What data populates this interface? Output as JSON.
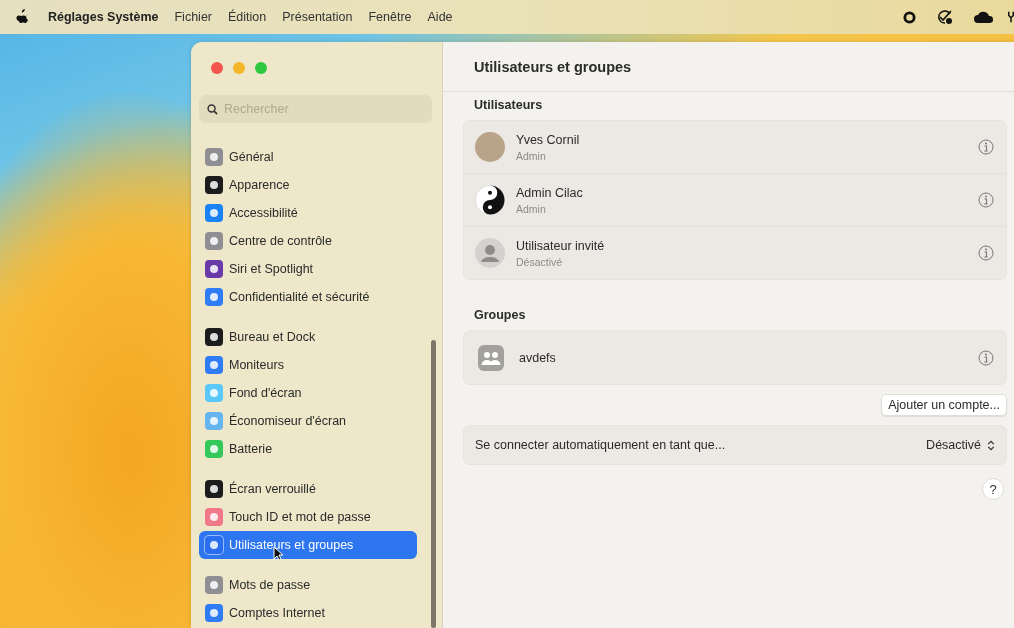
{
  "menu_bar": {
    "app_name": "Réglages Système",
    "menus": [
      "Fichier",
      "Édition",
      "Présentation",
      "Fenêtre",
      "Aide"
    ]
  },
  "sidebar": {
    "search": {
      "placeholder": "Rechercher"
    },
    "groups": [
      [
        {
          "label": "Général",
          "color": "#8e8e93",
          "selected": false
        },
        {
          "label": "Apparence",
          "color": "#1c1c1e",
          "selected": false
        },
        {
          "label": "Accessibilité",
          "color": "#1a82f7",
          "selected": false
        },
        {
          "label": "Centre de contrôle",
          "color": "#8e8e93",
          "selected": false
        },
        {
          "label": "Siri et Spotlight",
          "color": "#6a3aa8",
          "selected": false
        },
        {
          "label": "Confidentialité et sécurité",
          "color": "#2f7cf6",
          "selected": false
        }
      ],
      [
        {
          "label": "Bureau et Dock",
          "color": "#1c1c1e",
          "selected": false
        },
        {
          "label": "Moniteurs",
          "color": "#2f7cf6",
          "selected": false
        },
        {
          "label": "Fond d'écran",
          "color": "#5ac8fa",
          "selected": false
        },
        {
          "label": "Économiseur d'écran",
          "color": "#64b5f0",
          "selected": false
        },
        {
          "label": "Batterie",
          "color": "#34c759",
          "selected": false
        }
      ],
      [
        {
          "label": "Écran verrouillé",
          "color": "#1c1c1e",
          "selected": false
        },
        {
          "label": "Touch ID et mot de passe",
          "color": "#f07888",
          "selected": false
        },
        {
          "label": "Utilisateurs et groupes",
          "color": "#2a6ef0",
          "selected": true
        }
      ],
      [
        {
          "label": "Mots de passe",
          "color": "#8e8e93",
          "selected": false
        },
        {
          "label": "Comptes Internet",
          "color": "#2f7cf6",
          "selected": false
        }
      ]
    ]
  },
  "content": {
    "title": "Utilisateurs et groupes",
    "users_heading": "Utilisateurs",
    "users": [
      {
        "name": "Yves Cornil",
        "role": "Admin",
        "kind": "photo"
      },
      {
        "name": "Admin Cilac",
        "role": "Admin",
        "kind": "yinyang"
      },
      {
        "name": "Utilisateur invité",
        "role": "Désactivé",
        "kind": "silhouette"
      }
    ],
    "groups_heading": "Groupes",
    "groups": [
      {
        "name": "avdefs"
      }
    ],
    "add_button": "Ajouter un compte...",
    "auto_login": {
      "label": "Se connecter automatiquement en tant que...",
      "value": "Désactivé"
    },
    "help": "?"
  }
}
